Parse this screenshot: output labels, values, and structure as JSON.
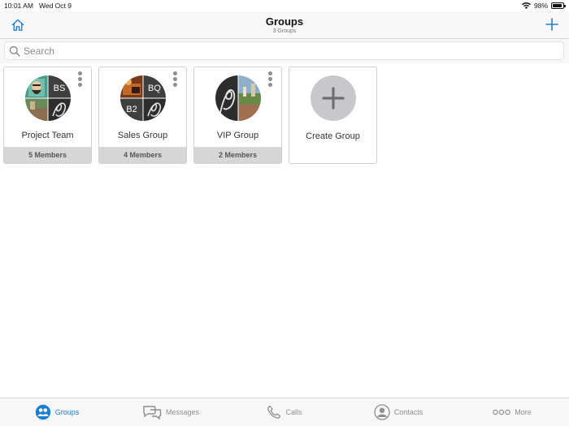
{
  "status_bar": {
    "time": "10:01 AM",
    "date": "Wed Oct 9",
    "battery": "98%"
  },
  "nav": {
    "title": "Groups",
    "subtitle": "3 Groups",
    "home_icon": "home-icon",
    "add_icon": "plus-icon"
  },
  "search": {
    "placeholder": "Search"
  },
  "groups": [
    {
      "name": "Project Team",
      "members": "5 Members",
      "tiles": [
        "BS",
        ""
      ]
    },
    {
      "name": "Sales Group",
      "members": "4 Members",
      "tiles": [
        "BQ",
        "B2"
      ]
    },
    {
      "name": "VIP Group",
      "members": "2 Members",
      "tiles": []
    }
  ],
  "create": {
    "label": "Create Group"
  },
  "tabs": [
    {
      "label": "Groups",
      "icon": "groups-icon",
      "active": true
    },
    {
      "label": "Messages",
      "icon": "messages-icon",
      "active": false
    },
    {
      "label": "Calls",
      "icon": "phone-icon",
      "active": false
    },
    {
      "label": "Contacts",
      "icon": "contact-icon",
      "active": false
    },
    {
      "label": "More",
      "icon": "more-icon",
      "active": false
    }
  ],
  "colors": {
    "accent": "#1a7fd4",
    "tile_dark": "#3a3a3a",
    "footer": "#d6d6d9"
  }
}
